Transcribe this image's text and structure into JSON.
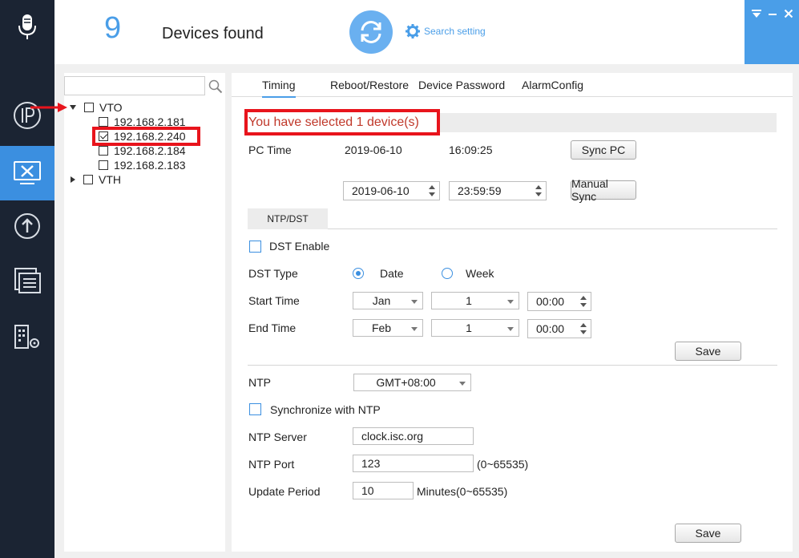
{
  "header": {
    "device_count": "9",
    "devices_found_label": "Devices found",
    "search_setting_label": "Search setting"
  },
  "tree": {
    "search": {
      "value": "",
      "placeholder": ""
    },
    "groups": [
      {
        "name": "VTO",
        "expanded": true,
        "devices": [
          {
            "ip": "192.168.2.181",
            "checked": false
          },
          {
            "ip": "192.168.2.240",
            "checked": true
          },
          {
            "ip": "192.168.2.184",
            "checked": false
          },
          {
            "ip": "192.168.2.183",
            "checked": false
          }
        ]
      },
      {
        "name": "VTH",
        "expanded": false,
        "devices": []
      }
    ]
  },
  "tabs": [
    "Timing",
    "Reboot/Restore",
    "Device Password",
    "AlarmConfig"
  ],
  "timing": {
    "selected_message": "You have selected 1 device(s)",
    "pc_time_label": "PC Time",
    "pc_date": "2019-06-10",
    "pc_time": "16:09:25",
    "sync_pc_label": "Sync PC",
    "manual_date": "2019-06-10",
    "manual_time": "23:59:59",
    "manual_sync_label": "Manual Sync",
    "subtab_label": "NTP/DST",
    "dst_enable_label": "DST Enable",
    "dst_type_label": "DST Type",
    "dst_type_options": [
      "Date",
      "Week"
    ],
    "dst_type_selected": "Date",
    "start_time_label": "Start Time",
    "start_month": "Jan",
    "start_day": "1",
    "start_time": "00:00",
    "end_time_label": "End Time",
    "end_month": "Feb",
    "end_day": "1",
    "end_time": "00:00",
    "save_label": "Save",
    "ntp_label": "NTP",
    "ntp_timezone": "GMT+08:00",
    "sync_ntp_label": "Synchronize with NTP",
    "ntp_server_label": "NTP Server",
    "ntp_server_value": "clock.isc.org",
    "ntp_port_label": "NTP Port",
    "ntp_port_value": "123",
    "ntp_port_range": "(0~65535)",
    "update_period_label": "Update Period",
    "update_period_value": "10",
    "update_period_unit": "Minutes(0~65535)",
    "save2_label": "Save"
  },
  "colors": {
    "accent": "#4a9ee8",
    "rail_bg": "#1b2433",
    "highlight": "#e8141c",
    "message_text": "#c0392b"
  },
  "icons": {
    "rail": [
      "microphone-icon",
      "ip-icon",
      "tools-icon",
      "upgrade-icon",
      "list-icon",
      "building-settings-icon"
    ],
    "header": [
      "refresh-icon",
      "gear-icon"
    ],
    "window": [
      "menu-down-icon",
      "minimize-icon",
      "close-icon"
    ]
  }
}
